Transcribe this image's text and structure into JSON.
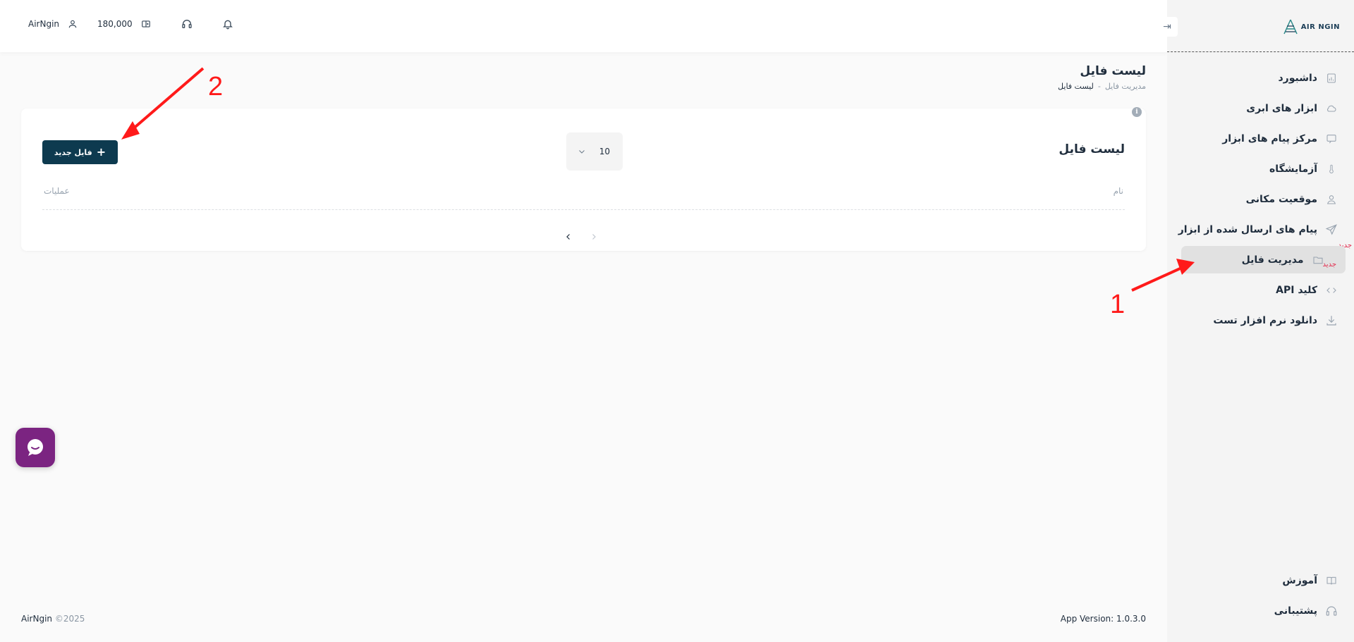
{
  "sidebar": {
    "logo_text": "AIR NGIN",
    "collapse_icon": "arrow-right-to-line-icon",
    "items": [
      {
        "label": "داشبورد",
        "icon": "chart-board-icon",
        "badge": ""
      },
      {
        "label": "ابزار های ابری",
        "icon": "cloud-icon",
        "badge": ""
      },
      {
        "label": "مرکز پیام های ابزار",
        "icon": "message-icon",
        "badge": ""
      },
      {
        "label": "آزمایشگاه",
        "icon": "thermometer-icon",
        "badge": ""
      },
      {
        "label": "موقعیت مکانی",
        "icon": "location-user-icon",
        "badge": ""
      },
      {
        "label": "پیام های ارسال شده از ابزار",
        "icon": "send-icon",
        "badge": "جدید"
      },
      {
        "label": "مدیریت فایل",
        "icon": "folder-icon",
        "badge": "جدید"
      },
      {
        "label": "کلید API",
        "icon": "code-icon",
        "badge": ""
      },
      {
        "label": "دانلود نرم افزار تست",
        "icon": "download-icon",
        "badge": ""
      }
    ],
    "bottom_items": [
      {
        "label": "آموزش",
        "icon": "book-icon"
      },
      {
        "label": "پشتیبانی",
        "icon": "headset-icon"
      }
    ]
  },
  "topbar": {
    "username": "AirNgin",
    "balance": "180,000"
  },
  "page": {
    "title": "لیست فایل",
    "breadcrumb_parent": "مدیریت فایل",
    "breadcrumb_sep": "-",
    "breadcrumb_current": "لیست فایل"
  },
  "card": {
    "title": "لیست فایل",
    "page_size": "10",
    "new_file_label": "فایل جدید",
    "col_name": "نام",
    "col_actions": "عملیات"
  },
  "footer": {
    "brand": "AirNgin",
    "copyright": "©2025",
    "version": "App Version: 1.0.3.0"
  },
  "annotations": {
    "label_1": "1",
    "label_2": "2",
    "color": "#ff1a1a"
  },
  "colors": {
    "primary_button": "#0d3a4f",
    "chat_bubble": "#7b2481",
    "badge": "#e2274a"
  }
}
